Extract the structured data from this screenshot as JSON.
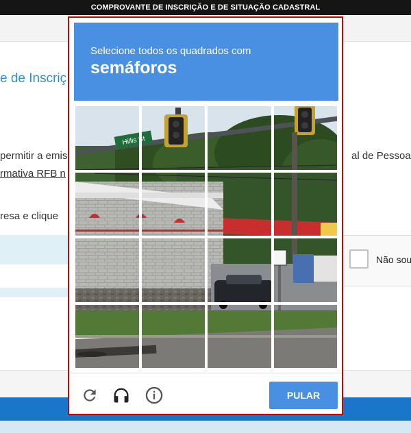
{
  "page": {
    "topbar_title": "COMPROVANTE DE INSCRIÇÃO E DE SITUAÇÃO CADASTRAL",
    "heading_fragment": "e de Inscriç",
    "text_lines": [
      "permitir a emis",
      "rmativa RFB n",
      "resa e clique"
    ],
    "text_right": "al de Pessoa J",
    "checkbox_label": "Não sou"
  },
  "captcha": {
    "instruction": "Selecione todos os quadrados com",
    "target": "semáforos",
    "street_sign": "Hillis St",
    "skip_label": "PULAR",
    "grid_size": 4,
    "icons": [
      "reload-icon",
      "headphones-icon",
      "info-icon"
    ],
    "colors": {
      "header": "#4a90e2",
      "border": "#d40000",
      "button": "#4a90e2"
    }
  }
}
